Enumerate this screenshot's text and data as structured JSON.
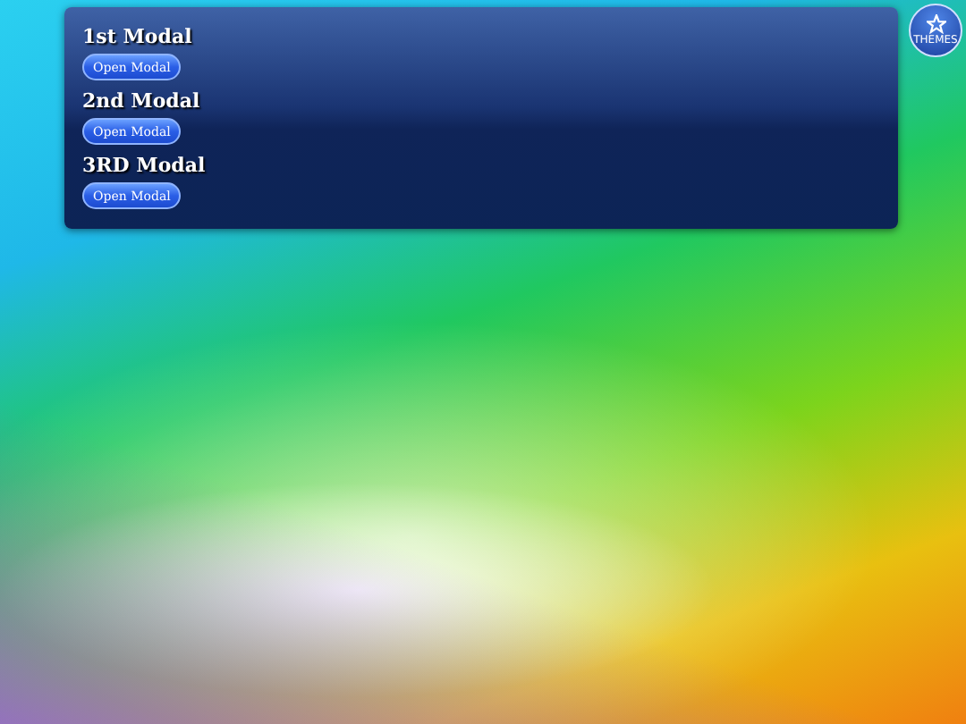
{
  "modals": [
    {
      "title": "1st Modal",
      "button": "Open Modal"
    },
    {
      "title": "2nd Modal",
      "button": "Open Modal"
    },
    {
      "title": "3RD Modal",
      "button": "Open Modal"
    }
  ],
  "themes_button": {
    "label": "THEMES"
  }
}
